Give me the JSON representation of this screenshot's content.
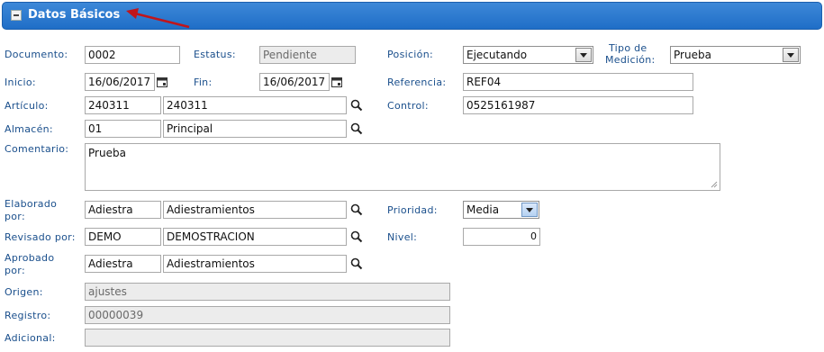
{
  "panel": {
    "title": "Datos Básicos"
  },
  "labels": {
    "documento": "Documento:",
    "estatus": "Estatus:",
    "posicion": "Posición:",
    "tipo_medicion_1": "Tipo de",
    "tipo_medicion_2": "Medición:",
    "inicio": "Inicio:",
    "fin": "Fin:",
    "referencia": "Referencia:",
    "articulo": "Artículo:",
    "control": "Control:",
    "almacen": "Almacén:",
    "comentario": "Comentario:",
    "elaborado_1": "Elaborado",
    "elaborado_2": "por:",
    "prioridad": "Prioridad:",
    "revisado": "Revisado por:",
    "nivel": "Nivel:",
    "aprobado_1": "Aprobado",
    "aprobado_2": "por:",
    "origen": "Origen:",
    "registro": "Registro:",
    "adicional": "Adicional:"
  },
  "values": {
    "documento": "0002",
    "estatus": "Pendiente",
    "posicion": "Ejecutando",
    "tipo_medicion": "Prueba",
    "inicio": "16/06/2017",
    "fin": "16/06/2017",
    "referencia": "REF04",
    "articulo_code": "240311",
    "articulo_name": "240311",
    "control": "0525161987",
    "almacen_code": "01",
    "almacen_name": "Principal",
    "comentario": "Prueba",
    "elaborado_code": "Adiestra",
    "elaborado_name": "Adiestramientos",
    "prioridad": "Media",
    "revisado_code": "DEMO",
    "revisado_name": "DEMOSTRACION",
    "nivel": "0",
    "aprobado_code": "Adiestra",
    "aprobado_name": "Adiestramientos",
    "origen": "ajustes",
    "registro": "00000039",
    "adicional": ""
  },
  "colors": {
    "header": "#1f6ec7",
    "label": "#1a4f8c",
    "arrow": "#c0151b"
  },
  "icons": [
    "collapse-icon",
    "calendar-icon",
    "magnifier-icon",
    "resize-grip-icon",
    "arrow-annotation-icon"
  ]
}
